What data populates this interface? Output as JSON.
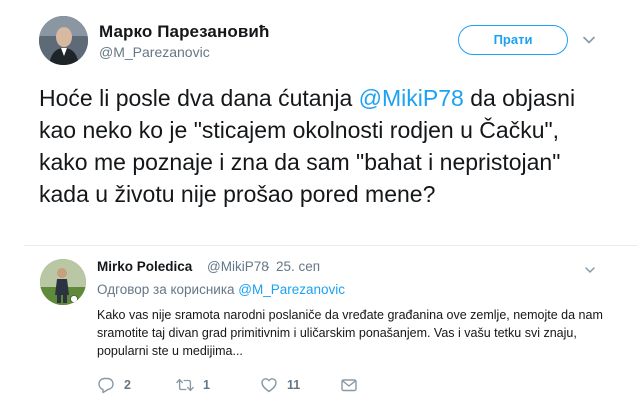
{
  "main_tweet": {
    "author_name": "Марко Парезановић",
    "author_handle": "@M_Parezanovic",
    "follow_label": "Прати",
    "text_before": "Hoće li posle dva dana ćutanja ",
    "mention": "@MikiP78",
    "text_after": " da objasni kao neko ko je \"sticajem okolnosti rodjen u Čačku\", kako me poznaje i zna da sam \"bahat i nepristojan\" kada u životu nije prošao pored mene?"
  },
  "reply_tweet": {
    "author_name": "Mirko Poledica",
    "author_handle": "@MikiP78",
    "separator": "·",
    "date": "25. сеп",
    "replying_prefix": "Одговор за корисника ",
    "replying_to": "@M_Parezanovic",
    "text": "Kako vas nije sramota narodni poslaniče da vređate građanina ove zemlje, nemojte da nam sramotite taj divan grad primitivnim i uličarskim ponašanjem. Vas i vašu tetku svi znaju, popularni ste u medijima...",
    "reply_count": "2",
    "retweet_count": "1",
    "like_count": "11"
  },
  "colors": {
    "accent": "#1da1f2",
    "secondary_text": "#657786",
    "primary_text": "#14171a",
    "divider": "#e6ecf0"
  },
  "icons": [
    "chevron-down-icon",
    "reply-icon",
    "retweet-icon",
    "like-icon",
    "direct-message-icon"
  ]
}
